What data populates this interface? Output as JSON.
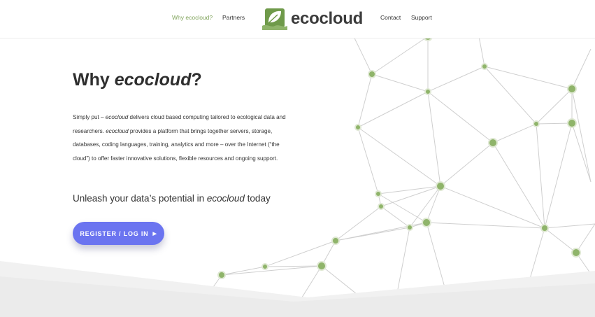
{
  "header": {
    "brand_name": "ecocloud",
    "logo_icon": "leaf-cloud-icon",
    "nav": {
      "why": "Why ecocloud?",
      "partners": "Partners",
      "contact": "Contact",
      "support": "Support"
    }
  },
  "hero": {
    "title_prefix": "Why ",
    "title_brand": "ecocloud",
    "title_suffix": "?",
    "body": {
      "p1": "Simply put – ",
      "b1": "ecocloud",
      "p2": " delivers cloud based computing tailored to ecological data and researchers. ",
      "b2": "ecocloud",
      "p3": " provides a platform that brings together servers, storage, databases, coding languages, training, analytics and more – over the Internet (“the cloud”) to offer faster innovative solutions, flexible resources and ongoing support."
    },
    "subheading_prefix": "Unleash your data’s potential in ",
    "subheading_brand": "ecocloud",
    "subheading_suffix": " today",
    "cta_label": "REGISTER / LOG IN"
  },
  "colors": {
    "accent_green": "#7fa35a",
    "node_green": "#8fb46a",
    "cta_purple": "#6b74f0"
  }
}
